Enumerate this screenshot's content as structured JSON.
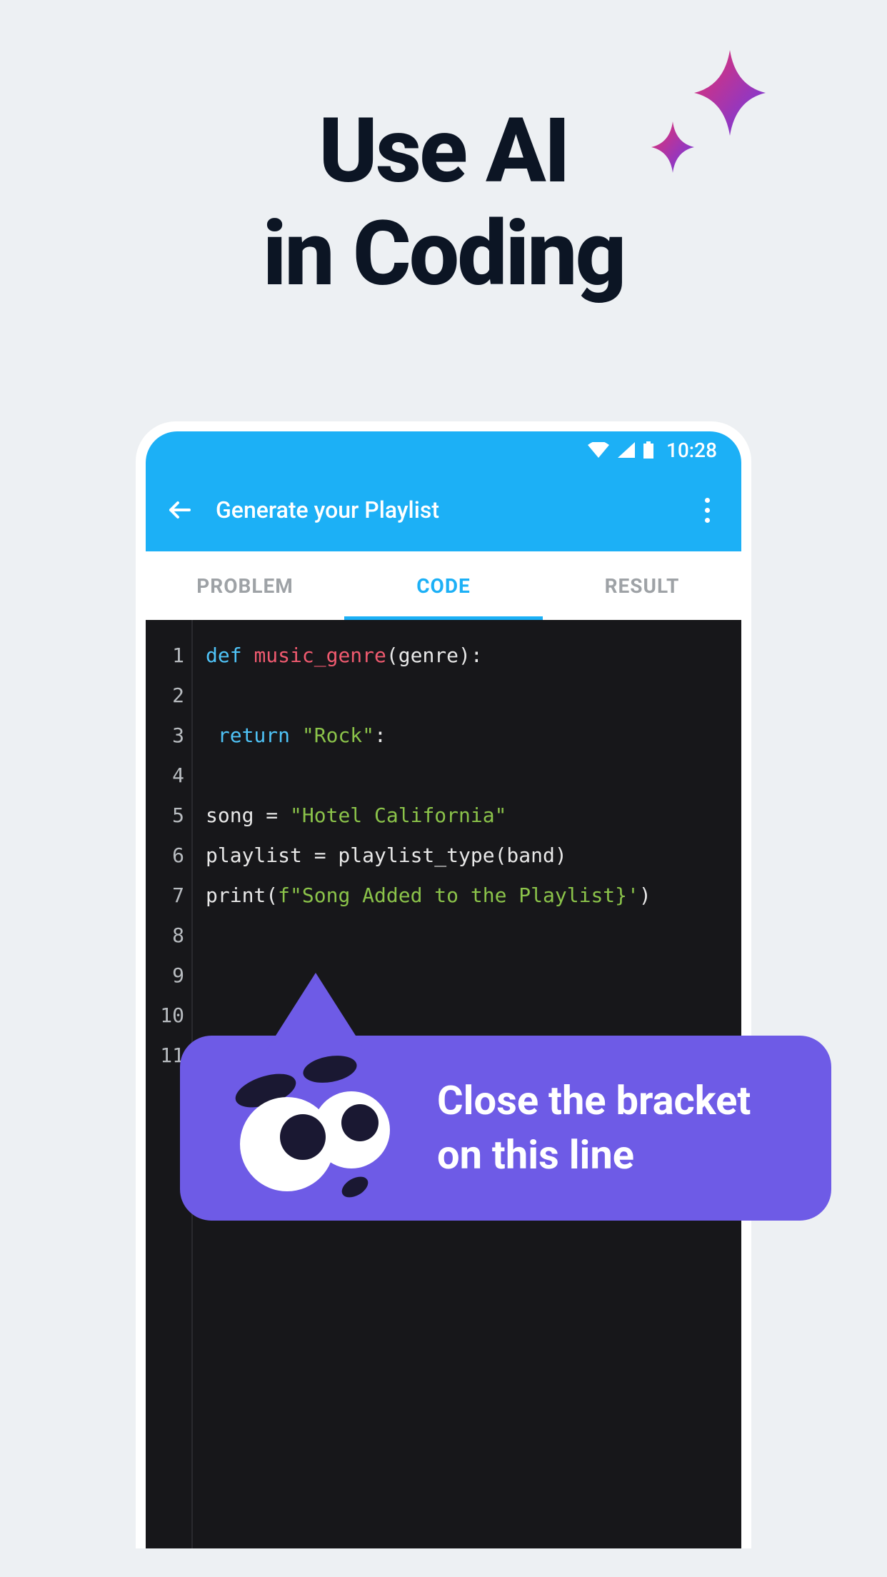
{
  "headline": {
    "line1": "Use AI",
    "line2": "in Coding"
  },
  "status_bar": {
    "time": "10:28"
  },
  "app_bar": {
    "title": "Generate your Playlist"
  },
  "tabs": [
    {
      "label": "PROBLEM",
      "active": false
    },
    {
      "label": "CODE",
      "active": true
    },
    {
      "label": "RESULT",
      "active": false
    }
  ],
  "editor": {
    "line_numbers": [
      "1",
      "2",
      "3",
      "4",
      "5",
      "6",
      "7",
      "8",
      "9",
      "10",
      "11"
    ],
    "code_lines": [
      {
        "segments": [
          {
            "t": "def ",
            "c": "kw"
          },
          {
            "t": "music_genre",
            "c": "fn"
          },
          {
            "t": "(genre):",
            "c": ""
          }
        ]
      },
      {
        "segments": [
          {
            "t": "",
            "c": ""
          }
        ]
      },
      {
        "segments": [
          {
            "t": " ",
            "c": ""
          },
          {
            "t": "return",
            "c": "kw"
          },
          {
            "t": " ",
            "c": ""
          },
          {
            "t": "\"Rock\"",
            "c": "str"
          },
          {
            "t": ":",
            "c": ""
          }
        ]
      },
      {
        "segments": [
          {
            "t": "",
            "c": ""
          }
        ]
      },
      {
        "segments": [
          {
            "t": "song = ",
            "c": ""
          },
          {
            "t": "\"Hotel California\"",
            "c": "str"
          }
        ]
      },
      {
        "segments": [
          {
            "t": "playlist = playlist_type(band)",
            "c": ""
          }
        ]
      },
      {
        "segments": [
          {
            "t": "print(",
            "c": ""
          },
          {
            "t": "f\"Song Added to the Playlist}'",
            "c": "str"
          },
          {
            "t": ")",
            "c": ""
          }
        ]
      },
      {
        "segments": [
          {
            "t": "",
            "c": ""
          }
        ]
      },
      {
        "segments": [
          {
            "t": "",
            "c": ""
          }
        ]
      },
      {
        "segments": [
          {
            "t": "",
            "c": ""
          }
        ]
      },
      {
        "segments": [
          {
            "t": "",
            "c": ""
          }
        ]
      }
    ]
  },
  "tooltip": {
    "text": "Close the bracket on this line"
  }
}
